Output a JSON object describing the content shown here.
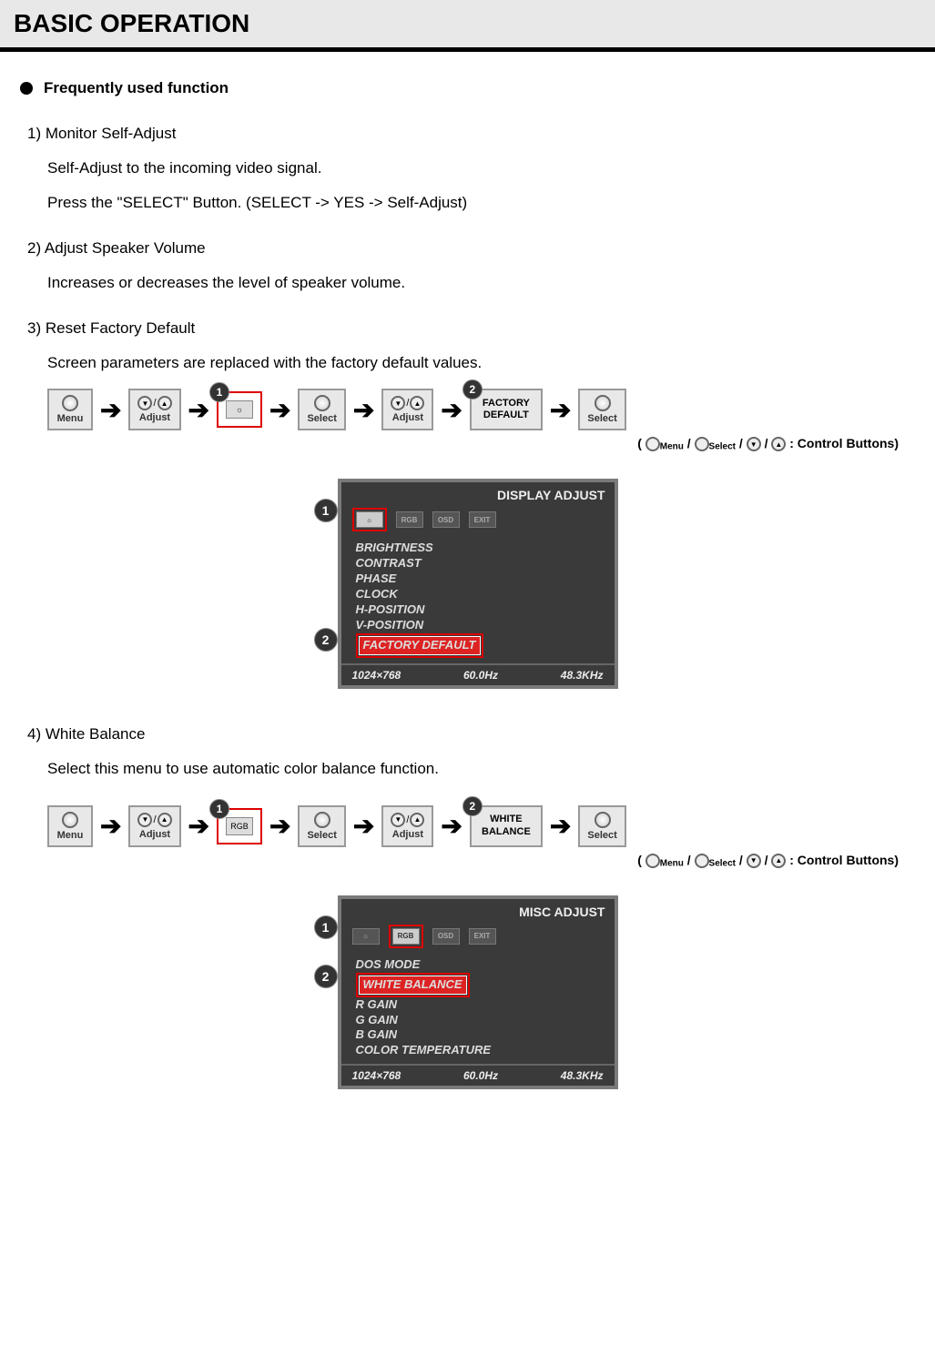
{
  "title": "BASIC OPERATION",
  "subheading": "Frequently used function",
  "sections": {
    "s1": {
      "title": "1) Monitor Self-Adjust",
      "line1": "Self-Adjust to the incoming video signal.",
      "line2": "Press the \"SELECT\" Button. (SELECT -> YES -> Self-Adjust)"
    },
    "s2": {
      "title": "2) Adjust Speaker Volume",
      "line1": "Increases or decreases the level of speaker volume."
    },
    "s3": {
      "title": "3) Reset Factory Default",
      "line1": "Screen parameters are replaced with the factory default values."
    },
    "s4": {
      "title": "4) White Balance",
      "line1": "Select this menu to use automatic color balance function."
    }
  },
  "btn": {
    "menu": "Menu",
    "adjust": "Adjust",
    "select": "Select",
    "factory_default": "FACTORY\nDEFAULT",
    "white_balance": "WHITE\nBALANCE",
    "rgb": "RGB"
  },
  "legend": ": Control Buttons)",
  "legend_menu": "Menu",
  "legend_select": "Select",
  "osd1": {
    "title": "DISPLAY ADJUST",
    "tabs": [
      "☼",
      "RGB",
      "OSD",
      "EXIT"
    ],
    "items": [
      "BRIGHTNESS",
      "CONTRAST",
      "PHASE",
      "CLOCK",
      "H-POSITION",
      "V-POSITION"
    ],
    "selected": "FACTORY DEFAULT",
    "footer": {
      "res": "1024×768",
      "hz": "60.0Hz",
      "khz": "48.3KHz"
    }
  },
  "osd2": {
    "title": "MISC ADJUST",
    "tabs": [
      "☼",
      "RGB",
      "OSD",
      "EXIT"
    ],
    "top": "DOS MODE",
    "selected": "WHITE BALANCE",
    "items": [
      "R GAIN",
      "G GAIN",
      "B GAIN",
      "COLOR TEMPERATURE"
    ],
    "footer": {
      "res": "1024×768",
      "hz": "60.0Hz",
      "khz": "48.3KHz"
    }
  }
}
